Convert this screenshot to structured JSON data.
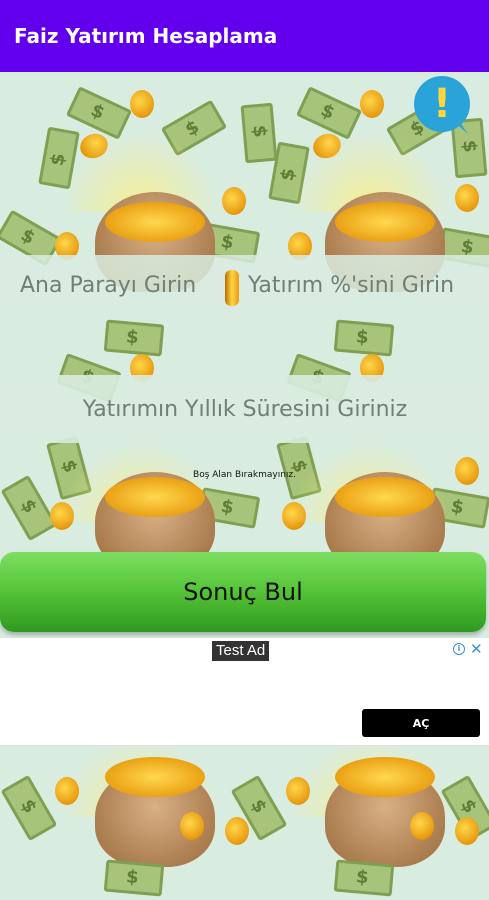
{
  "app": {
    "title": "Faiz Yatırım Hesaplama"
  },
  "form": {
    "principal_placeholder": "Ana Parayı Girin",
    "rate_placeholder": "Yatırım %'sini Girin",
    "years_placeholder": "Yatırımın Yıllık Süresini Giriniz",
    "warning": "Boş Alan Bırakmayınız."
  },
  "actions": {
    "result_label": "Sonuç Bul"
  },
  "ad": {
    "label": "Test Ad",
    "open_label": "AÇ",
    "close_glyph": "✕",
    "info_glyph": "i"
  },
  "info_button": {
    "glyph": "!"
  },
  "colors": {
    "appbar": "#6200ee",
    "button": "#58c63a",
    "background": "#d9ece0",
    "info": "#2aa3d8"
  }
}
